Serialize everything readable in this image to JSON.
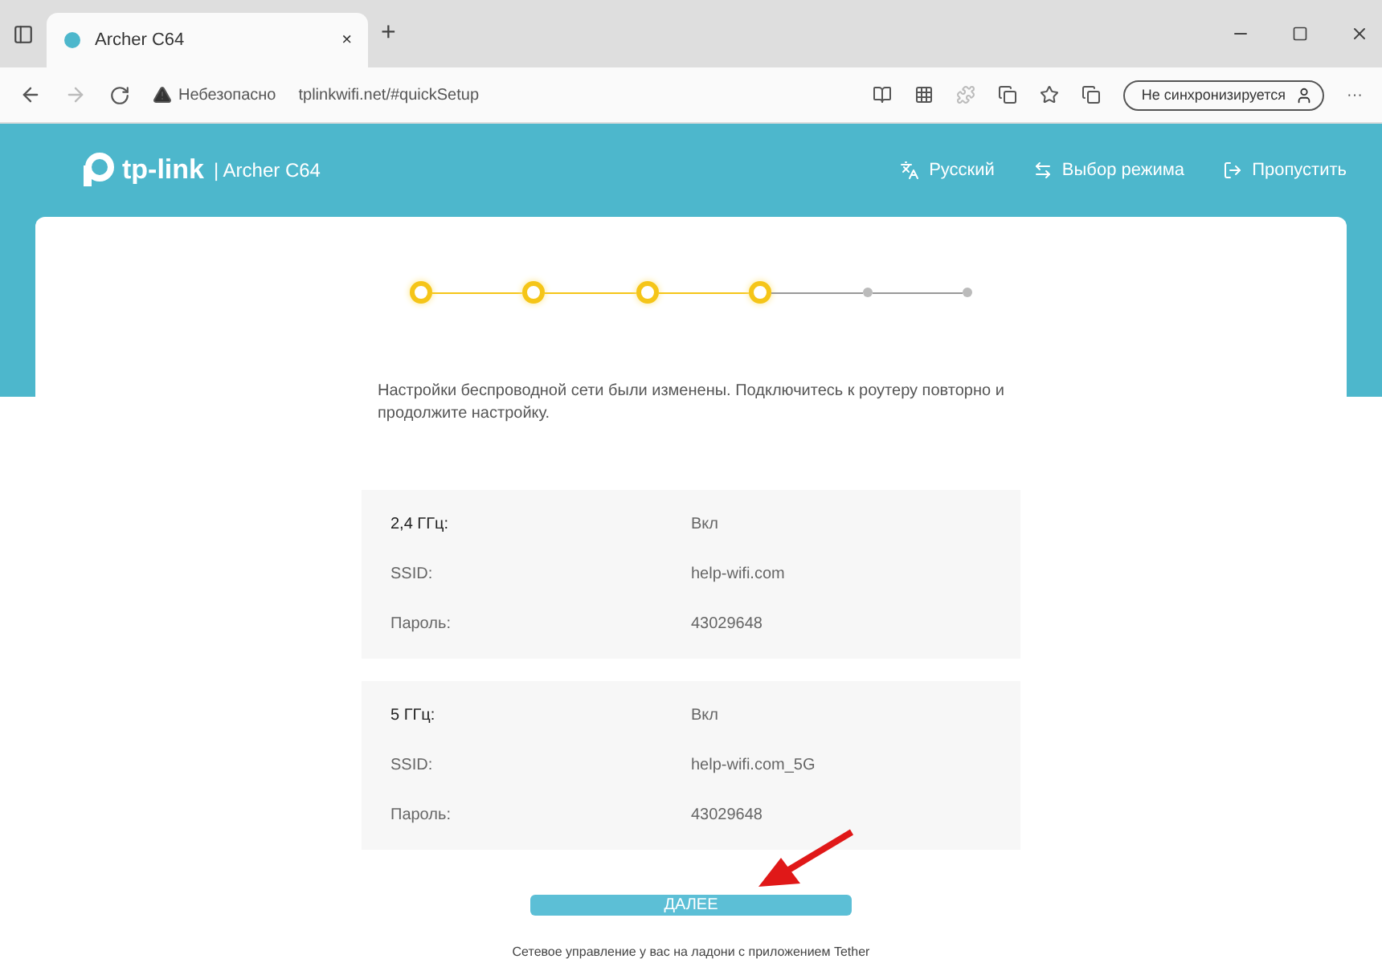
{
  "browser": {
    "tab_title": "Archer C64",
    "tab_close": "×",
    "new_tab": "+",
    "security": "Небезопасно",
    "url": "tplinkwifi.net/#quickSetup",
    "profile": "Не синхронизируется",
    "more": "···"
  },
  "header": {
    "brand": "tp-link",
    "model": "| Archer C64",
    "actions": [
      {
        "kind": "language",
        "label": "Русский"
      },
      {
        "kind": "mode",
        "label": "Выбор режима"
      },
      {
        "kind": "skip",
        "label": "Пропустить"
      }
    ]
  },
  "steps": [
    {
      "done": true
    },
    {
      "done": true
    },
    {
      "done": true
    },
    {
      "done": true
    },
    {
      "done": false
    },
    {
      "done": false
    }
  ],
  "message": "Настройки беспроводной сети были изменены. Подключитесь к роутеру повторно и продолжите настройку.",
  "bands": [
    {
      "rows": [
        {
          "label": "2,4 ГГц:",
          "value": "Вкл"
        },
        {
          "label": "SSID:",
          "value": "help-wifi.com"
        },
        {
          "label": "Пароль:",
          "value": "43029648"
        }
      ]
    },
    {
      "rows": [
        {
          "label": "5 ГГц:",
          "value": "Вкл"
        },
        {
          "label": "SSID:",
          "value": "help-wifi.com_5G"
        },
        {
          "label": "Пароль:",
          "value": "43029648"
        }
      ]
    }
  ],
  "next_button": "ДАЛЕЕ",
  "footer_note": "Сетевое управление у вас на ладони с приложением Tether"
}
